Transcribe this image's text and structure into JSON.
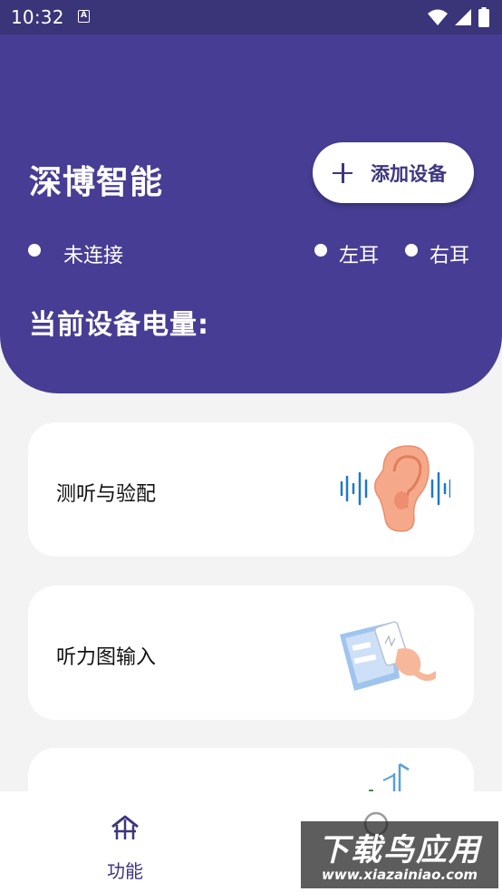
{
  "status_bar": {
    "time": "10:32",
    "notification_glyph": "A"
  },
  "header": {
    "brand": "深博智能",
    "add_device_label": "添加设备",
    "connection_status": "未连接",
    "left_ear": "左耳",
    "right_ear": "右耳",
    "battery_label": "当前设备电量:"
  },
  "cards": [
    {
      "label": "测听与验配",
      "icon": "ear-soundwave-icon"
    },
    {
      "label": "听力图输入",
      "icon": "audiogram-phone-icon"
    },
    {
      "label": "",
      "icon": "music-note-icon"
    }
  ],
  "bottom_nav": {
    "items": [
      {
        "label": "功能",
        "icon": "home-icon",
        "active": true
      },
      {
        "label": "",
        "icon": "profile-icon",
        "active": false
      }
    ]
  },
  "watermark": {
    "title": "下载鸟应用",
    "url": "www.xiazainiao.com"
  },
  "colors": {
    "header": "#473d94",
    "accent": "#3d3680",
    "background": "#f3f3f3",
    "card": "#ffffff"
  }
}
